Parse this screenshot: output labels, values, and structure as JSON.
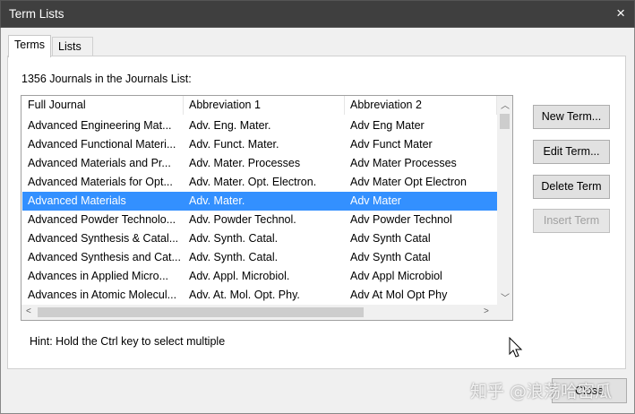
{
  "window": {
    "title": "Term Lists",
    "close_icon": "×"
  },
  "tabs": [
    {
      "label": "Terms"
    },
    {
      "label": "Lists"
    }
  ],
  "count_label": "1356 Journals in the Journals List:",
  "table": {
    "headers": [
      "Full Journal",
      "Abbreviation 1",
      "Abbreviation 2"
    ],
    "rows": [
      [
        "Advanced Engineering Mat...",
        "Adv. Eng. Mater.",
        "Adv Eng Mater"
      ],
      [
        "Advanced Functional Materi...",
        "Adv. Funct. Mater.",
        "Adv Funct Mater"
      ],
      [
        "Advanced Materials and Pr...",
        "Adv. Mater. Processes",
        "Adv Mater Processes"
      ],
      [
        "Advanced Materials for Opt...",
        "Adv. Mater. Opt. Electron.",
        "Adv Mater Opt Electron"
      ],
      [
        "Advanced Materials",
        "Adv. Mater.",
        "Adv Mater"
      ],
      [
        "Advanced Powder Technolo...",
        "Adv. Powder Technol.",
        "Adv Powder Technol"
      ],
      [
        "Advanced Synthesis & Catal...",
        "Adv. Synth. Catal.",
        "Adv Synth Catal"
      ],
      [
        "Advanced Synthesis and Cat...",
        "Adv. Synth. Catal.",
        "Adv Synth Catal"
      ],
      [
        "Advances in Applied Micro...",
        "Adv. Appl. Microbiol.",
        "Adv Appl Microbiol"
      ],
      [
        "Advances in Atomic Molecul...",
        "Adv. At. Mol. Opt. Phy.",
        "Adv At Mol Opt Phy"
      ]
    ],
    "selected_index": 4
  },
  "buttons": {
    "new_term": "New Term...",
    "edit_term": "Edit Term...",
    "delete_term": "Delete Term",
    "insert_term": "Insert Term",
    "close": "Close"
  },
  "hint": "Hint: Hold the Ctrl key to select multiple",
  "watermark": "知乎 @浪荡哈密瓜",
  "colors": {
    "selection": "#3390ff",
    "titlebar": "#3f3f3f"
  }
}
